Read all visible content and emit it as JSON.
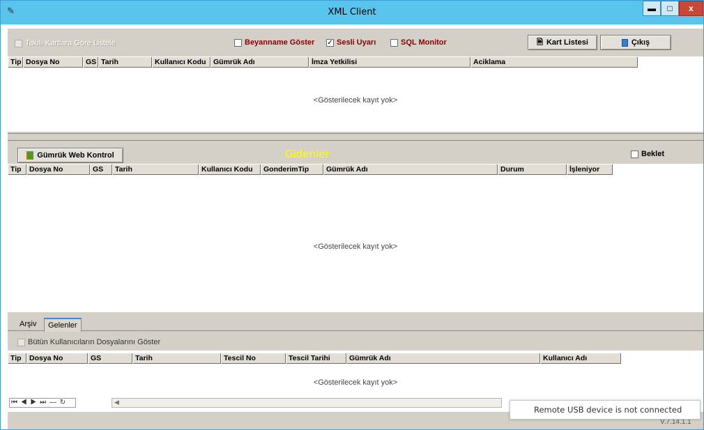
{
  "window": {
    "title": "XML Client",
    "app_icon": "clipboard-edit-icon",
    "controls": {
      "minimize": "▬",
      "maximize": "□",
      "close": "x"
    }
  },
  "top_toolbar": {
    "takili_label": "Takılı Kartlara Göre Listele",
    "beyanname_label": "Beyanname Göster",
    "sesli_label": "Sesli Uyarı",
    "sql_label": "SQL Monitor",
    "sesli_checked": "✓",
    "kart_listesi_label": "Kart Listesi",
    "cikis_label": "Çıkış"
  },
  "grid1": {
    "columns": [
      "Tip",
      "Dosya No",
      "GS",
      "Tarih",
      "Kullanıcı Kodu",
      "Gümrük Adı",
      "İmza Yetkilisi",
      "Aciklama"
    ],
    "empty_text": "<Gösterilecek kayıt yok>"
  },
  "outgoing": {
    "web_kontrol_label": "Gümrük Web Kontrol",
    "section_title": "Gidenler",
    "beklet_label": "Beklet",
    "columns": [
      "Tip",
      "Dosya No",
      "GS",
      "Tarih",
      "Kullanıcı Kodu",
      "GonderimTip",
      "Gümrük Adı",
      "Durum",
      "İşleniyor"
    ],
    "empty_text": "<Gösterilecek kayıt yok>"
  },
  "tabs": [
    "Arşiv",
    "Gelenler"
  ],
  "incoming": {
    "show_all_label": "Bütün Kullanıcıların Dosyalarını Göster",
    "columns": [
      "Tip",
      "Dosya No",
      "GS",
      "Tarih",
      "Tescil No",
      "Tescil Tarihi",
      "Gümrük Adı",
      "Kullanıcı Adı"
    ],
    "empty_text": "<Gösterilecek kayıt yok>",
    "navigator": "⏮ ◀ ▶ ⏭ — ↻"
  },
  "notification": {
    "text": "Remote USB device is not connected"
  },
  "version": "V.7.14.1.1"
}
